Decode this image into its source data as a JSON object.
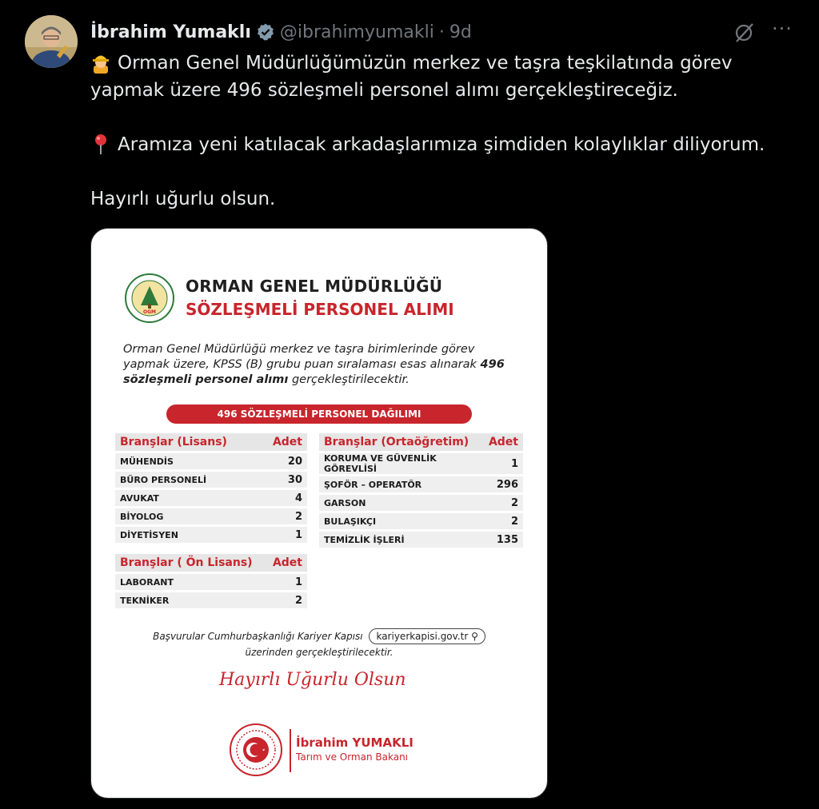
{
  "post": {
    "display_name": "İbrahim Yumaklı",
    "handle": "@ibrahimyumakli",
    "separator": "·",
    "time": "9d",
    "more": "···",
    "paragraphs": [
      {
        "emoji": "construction-worker-emoji",
        "text": "Orman Genel Müdürlüğümüzün merkez ve taşra teşkilatında görev yapmak üzere 496 sözleşmeli personel alımı gerçekleştireceğiz."
      },
      {
        "emoji": "round-pushpin-emoji",
        "text": "Aramıza yeni katılacak arkadaşlarımıza şimdiden kolaylıklar diliyorum."
      },
      {
        "emoji": "",
        "text": "Hayırlı uğurlu olsun."
      }
    ]
  },
  "card": {
    "title": "ORMAN GENEL MÜDÜRLÜĞÜ",
    "subtitle": "SÖZLEŞMELİ PERSONEL ALIMI",
    "logo_text": "OGM",
    "intro_part1": "Orman Genel Müdürlüğü merkez ve taşra birimlerinde görev yapmak üzere, KPSS (B) grubu puan sıralaması esas alınarak ",
    "intro_bold": "496 sözleşmeli personel alımı",
    "intro_part2": " gerçekleştirilecektir.",
    "distribution_title": "496 SÖZLEŞMELİ PERSONEL DAĞILIMI",
    "lisans": {
      "header": "Branşlar (Lisans)",
      "count_header": "Adet",
      "rows": [
        {
          "name": "MÜHENDİS",
          "count": "20"
        },
        {
          "name": "BÜRO PERSONELİ",
          "count": "30"
        },
        {
          "name": "AVUKAT",
          "count": "4"
        },
        {
          "name": "BİYOLOG",
          "count": "2"
        },
        {
          "name": "DİYETİSYEN",
          "count": "1"
        }
      ]
    },
    "ortaogretim": {
      "header": "Branşlar (Ortaöğretim)",
      "count_header": "Adet",
      "rows": [
        {
          "name": "KORUMA VE GÜVENLİK GÖREVLİSİ",
          "count": "1"
        },
        {
          "name": "ŞOFÖR – OPERATÖR",
          "count": "296"
        },
        {
          "name": "GARSON",
          "count": "2"
        },
        {
          "name": "BULAŞIKÇI",
          "count": "2"
        },
        {
          "name": "TEMİZLİK İŞLERİ",
          "count": "135"
        }
      ]
    },
    "onlisans": {
      "header": "Branşlar ( Ön Lisans)",
      "count_header": "Adet",
      "rows": [
        {
          "name": "LABORANT",
          "count": "1"
        },
        {
          "name": "TEKNİKER",
          "count": "2"
        }
      ]
    },
    "apply_text": "Başvurular Cumhurbaşkanlığı Kariyer Kapısı",
    "apply_site": "kariyerkapisi.gov.tr",
    "apply_text2": "üzerinden gerçekleştirilecektir.",
    "signature": "Hayırlı Uğurlu Olsun",
    "minister_name": "İbrahim YUMAKLI",
    "minister_title": "Tarım ve Orman Bakanı"
  },
  "colors": {
    "accent_red": "#c8252c",
    "verified_gray": "#829aab",
    "muted": "#71767b"
  }
}
